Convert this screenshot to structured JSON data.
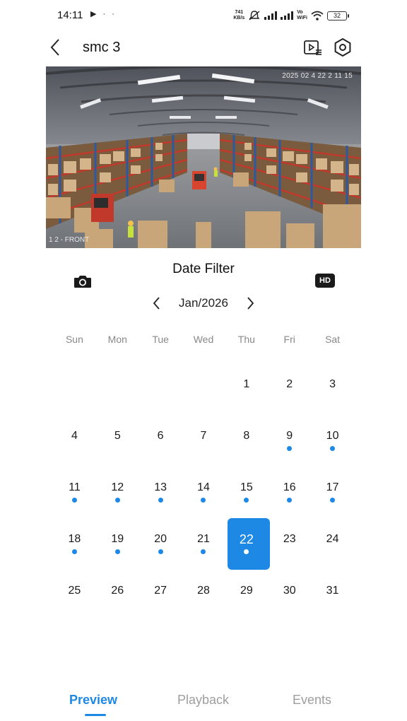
{
  "status_bar": {
    "time": "14:11",
    "left_icons": "▶ · ·",
    "net_speed_value": "741",
    "net_speed_unit": "KB/s",
    "vowifi_top": "Vo",
    "vowifi_bottom": "WiFi",
    "battery": "32"
  },
  "header": {
    "title": "smc 3"
  },
  "video": {
    "timestamp": "2025 02 4 22 2 11 15",
    "camera_label": "1 2 - FRONT"
  },
  "controls": {
    "date_filter_title": "Date Filter",
    "hd_label": "HD"
  },
  "calendar": {
    "month_label": "Jan/2026",
    "weekdays": [
      "Sun",
      "Mon",
      "Tue",
      "Wed",
      "Thu",
      "Fri",
      "Sat"
    ],
    "leading_blank_days": 4,
    "days": [
      {
        "n": "1",
        "dot": false
      },
      {
        "n": "2",
        "dot": false
      },
      {
        "n": "3",
        "dot": false
      },
      {
        "n": "4",
        "dot": false
      },
      {
        "n": "5",
        "dot": false
      },
      {
        "n": "6",
        "dot": false
      },
      {
        "n": "7",
        "dot": false
      },
      {
        "n": "8",
        "dot": false
      },
      {
        "n": "9",
        "dot": true
      },
      {
        "n": "10",
        "dot": true
      },
      {
        "n": "11",
        "dot": true
      },
      {
        "n": "12",
        "dot": true
      },
      {
        "n": "13",
        "dot": true
      },
      {
        "n": "14",
        "dot": true
      },
      {
        "n": "15",
        "dot": true
      },
      {
        "n": "16",
        "dot": true
      },
      {
        "n": "17",
        "dot": true
      },
      {
        "n": "18",
        "dot": true
      },
      {
        "n": "19",
        "dot": true
      },
      {
        "n": "20",
        "dot": true
      },
      {
        "n": "21",
        "dot": true
      },
      {
        "n": "22",
        "dot": true,
        "selected": true
      },
      {
        "n": "23",
        "dot": false
      },
      {
        "n": "24",
        "dot": false
      },
      {
        "n": "25",
        "dot": false
      },
      {
        "n": "26",
        "dot": false
      },
      {
        "n": "27",
        "dot": false
      },
      {
        "n": "28",
        "dot": false
      },
      {
        "n": "29",
        "dot": false
      },
      {
        "n": "30",
        "dot": false
      },
      {
        "n": "31",
        "dot": false
      }
    ],
    "accent_color": "#1e88e5"
  },
  "tabs": {
    "items": [
      "Preview",
      "Playback",
      "Events"
    ],
    "active": "Preview"
  }
}
